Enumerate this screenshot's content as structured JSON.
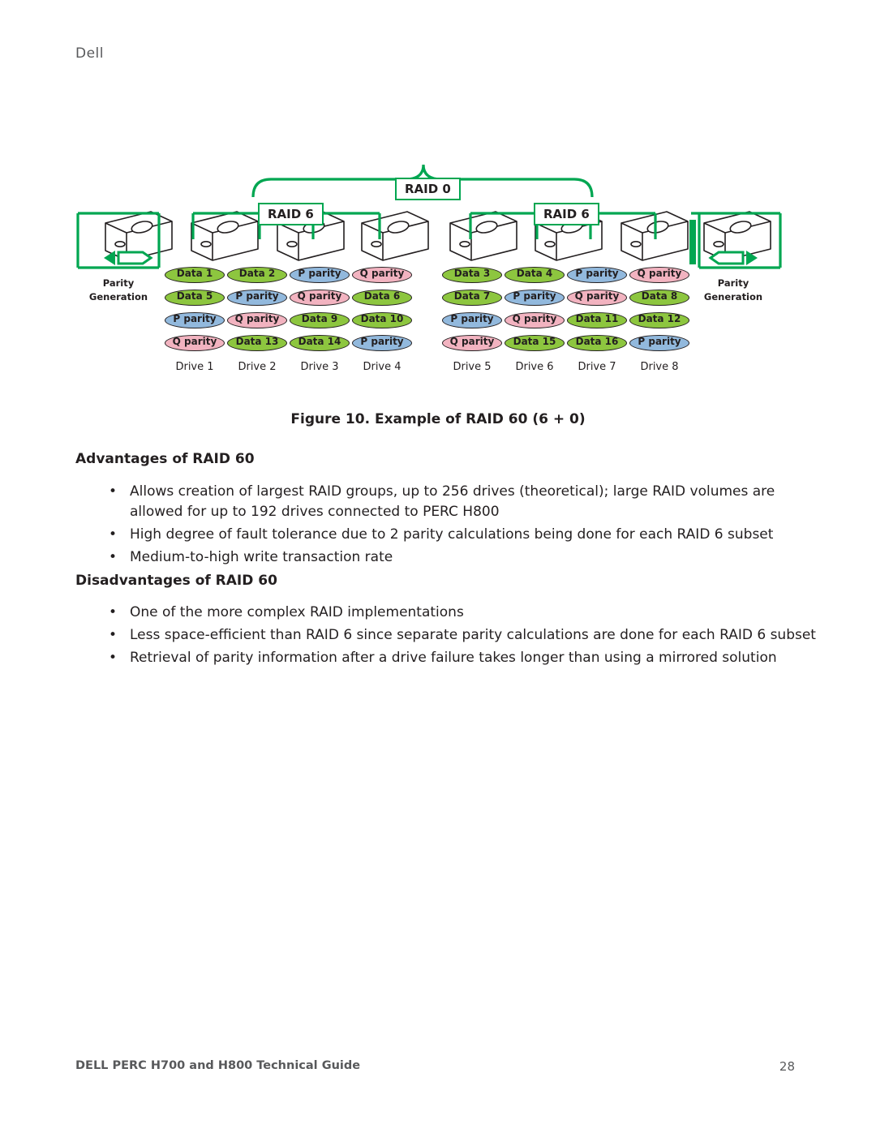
{
  "brand": "Dell",
  "figure": {
    "raid0_label": "RAID 0",
    "raid6_left_label": "RAID 6",
    "raid6_right_label": "RAID 6",
    "parity_left": {
      "line1": "Parity",
      "line2": "Generation"
    },
    "parity_right": {
      "line1": "Parity",
      "line2": "Generation"
    },
    "caption": "Figure 10.  Example of RAID 60 (6 + 0)",
    "drives": [
      {
        "name": "Drive 1",
        "blocks": [
          {
            "label": "Data 1",
            "color": "green"
          },
          {
            "label": "Data 5",
            "color": "green"
          },
          {
            "label": "P parity",
            "color": "blue"
          },
          {
            "label": "Q parity",
            "color": "pink"
          }
        ]
      },
      {
        "name": "Drive 2",
        "blocks": [
          {
            "label": "Data 2",
            "color": "green"
          },
          {
            "label": "P parity",
            "color": "blue"
          },
          {
            "label": "Q parity",
            "color": "pink"
          },
          {
            "label": "Data 13",
            "color": "green"
          }
        ]
      },
      {
        "name": "Drive 3",
        "blocks": [
          {
            "label": "P parity",
            "color": "blue"
          },
          {
            "label": "Q parity",
            "color": "pink"
          },
          {
            "label": "Data 9",
            "color": "green"
          },
          {
            "label": "Data 14",
            "color": "green"
          }
        ]
      },
      {
        "name": "Drive 4",
        "blocks": [
          {
            "label": "Q parity",
            "color": "pink"
          },
          {
            "label": "Data 6",
            "color": "green"
          },
          {
            "label": "Data 10",
            "color": "green"
          },
          {
            "label": "P parity",
            "color": "blue"
          }
        ]
      },
      {
        "name": "Drive 5",
        "blocks": [
          {
            "label": "Data 3",
            "color": "green"
          },
          {
            "label": "Data 7",
            "color": "green"
          },
          {
            "label": "P parity",
            "color": "blue"
          },
          {
            "label": "Q parity",
            "color": "pink"
          }
        ]
      },
      {
        "name": "Drive 6",
        "blocks": [
          {
            "label": "Data 4",
            "color": "green"
          },
          {
            "label": "P parity",
            "color": "blue"
          },
          {
            "label": "Q parity",
            "color": "pink"
          },
          {
            "label": "Data 15",
            "color": "green"
          }
        ]
      },
      {
        "name": "Drive 7",
        "blocks": [
          {
            "label": "P parity",
            "color": "blue"
          },
          {
            "label": "Q parity",
            "color": "pink"
          },
          {
            "label": "Data 11",
            "color": "green"
          },
          {
            "label": "Data 16",
            "color": "green"
          }
        ]
      },
      {
        "name": "Drive 8",
        "blocks": [
          {
            "label": "Q parity",
            "color": "pink"
          },
          {
            "label": "Data 8",
            "color": "green"
          },
          {
            "label": "Data 12",
            "color": "green"
          },
          {
            "label": "P parity",
            "color": "blue"
          }
        ]
      }
    ]
  },
  "sections": [
    {
      "heading": "Advantages of RAID 60",
      "bullets": [
        "Allows creation of largest RAID groups, up to 256 drives (theoretical); large RAID volumes are allowed for up to 192 drives connected to PERC H800",
        "High degree of fault tolerance due to 2 parity calculations being done for each RAID 6 subset",
        "Medium-to-high write transaction rate"
      ]
    },
    {
      "heading": "Disadvantages of RAID 60",
      "bullets": [
        "One of the more complex RAID implementations",
        "Less space-efficient than RAID 6 since separate parity calculations are done for each RAID 6 subset",
        "Retrieval of parity information after a drive failure takes longer than using a mirrored solution"
      ]
    }
  ],
  "footer": {
    "left": "DELL PERC H700 and H800 Technical Guide",
    "page": "28"
  },
  "colors": {
    "green_accent": "#00a651",
    "data_green": "#8dc63f",
    "p_parity_blue": "#92b9dd",
    "q_parity_pink": "#f2b3c0",
    "text": "#231f20",
    "muted": "#58595b"
  }
}
